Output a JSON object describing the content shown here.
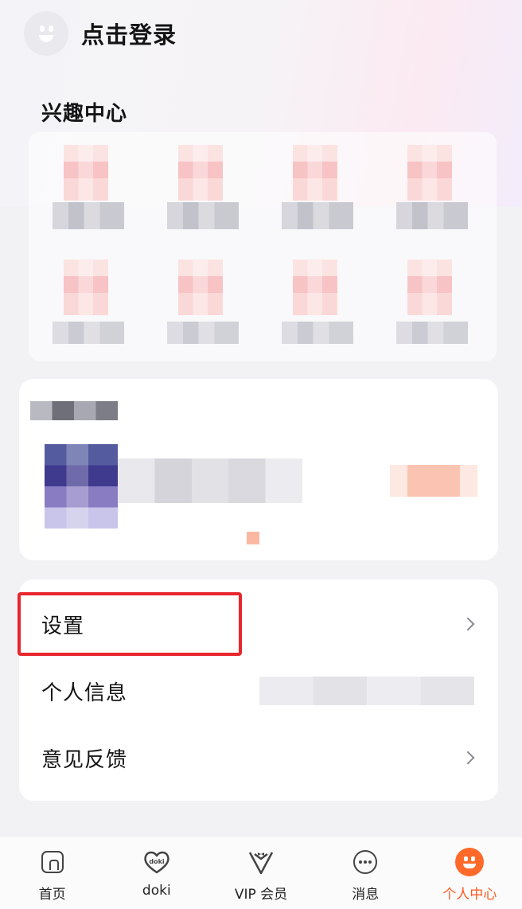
{
  "header": {
    "login_text": "点击登录"
  },
  "interest": {
    "title": "兴趣中心"
  },
  "settings": {
    "items": [
      {
        "label": "设置",
        "icon": "chevron-right-icon"
      },
      {
        "label": "个人信息"
      },
      {
        "label": "意见反馈",
        "icon": "chevron-right-icon"
      }
    ]
  },
  "tabbar": {
    "items": [
      {
        "label": "首页",
        "icon": "home-icon"
      },
      {
        "label": "doki",
        "icon": "doki-heart-icon"
      },
      {
        "label": "VIP 会员",
        "icon": "vip-icon"
      },
      {
        "label": "消息",
        "icon": "message-icon"
      },
      {
        "label": "个人中心",
        "icon": "profile-icon",
        "active": true
      }
    ]
  },
  "colors": {
    "accent": "#ff5a1f",
    "highlight": "#e8262e"
  }
}
